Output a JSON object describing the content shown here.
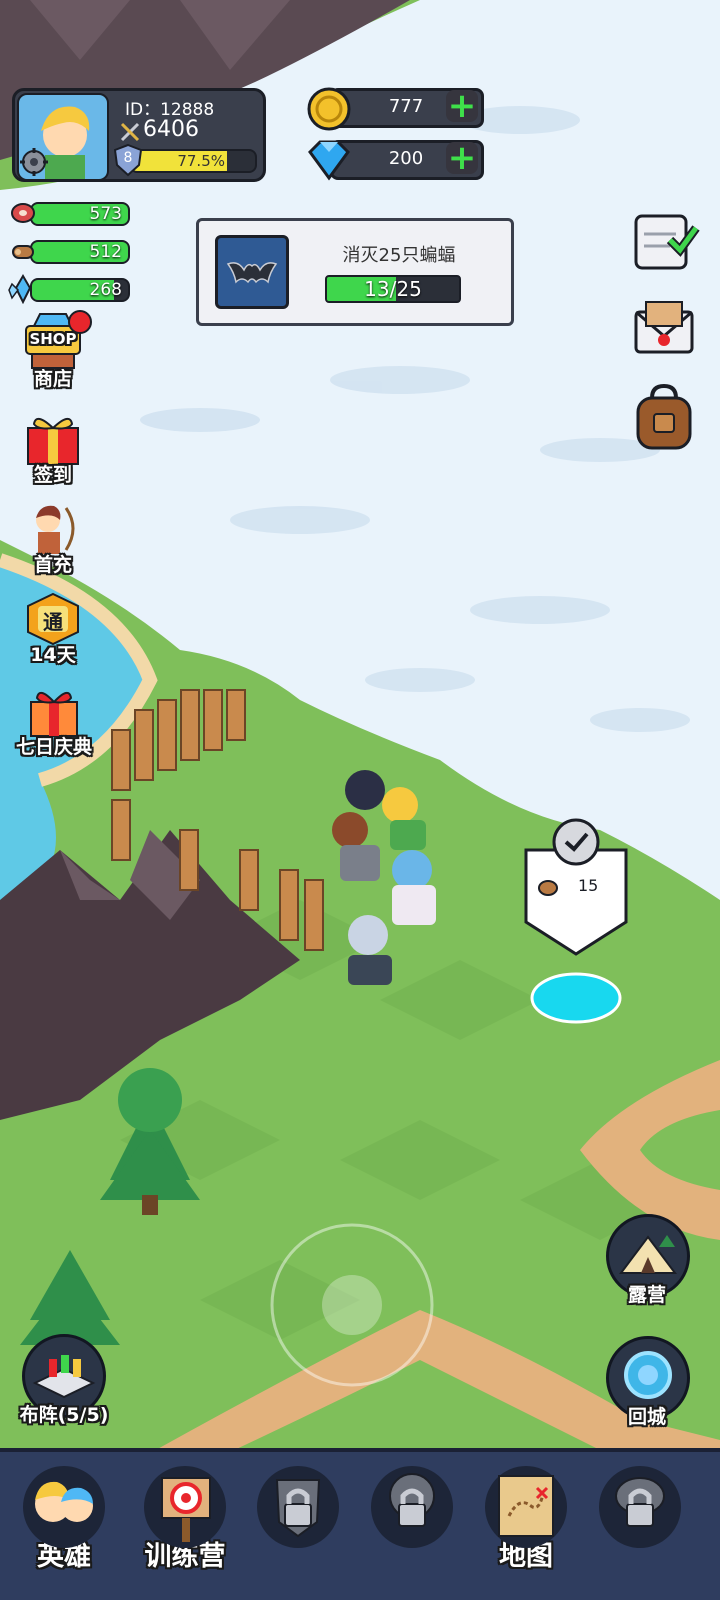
{
  "player": {
    "id_label": "ID：12888",
    "power": "6406",
    "level": "8",
    "exp_percent": "77.5%",
    "exp_fraction": 0.775
  },
  "currency": {
    "gold": "777",
    "gems": "200"
  },
  "resources": {
    "meat": "573",
    "wood": "512",
    "crystal": "268"
  },
  "quest": {
    "title": "消灭25只蝙蝠",
    "progress": "13/25",
    "fraction": 0.52
  },
  "left_menu": {
    "shop_badge": "SHOP",
    "shop": "商店",
    "checkin": "签到",
    "first_recharge": "首充",
    "pass_badge": "通",
    "pass_days": "14天",
    "seven_day": "七日庆典"
  },
  "map_marker": {
    "cost": "15"
  },
  "right_buttons": {
    "camp": "露营",
    "return_city": "回城",
    "formation": "布阵(5/5)"
  },
  "nav": {
    "heroes": "英雄",
    "training": "训练营",
    "map": "地图"
  },
  "colors": {
    "exp_bar": "#f1e23a",
    "resource_bar": "#3fd64c",
    "quest_bar": "#3fd64c",
    "grass": "#7fbf5a",
    "snow": "#e9f3fb"
  },
  "icons": [
    "settings-gear-icon",
    "sword-icon",
    "shield-level-icon",
    "gold-coin-icon",
    "gem-icon",
    "plus-icon",
    "meat-icon",
    "wood-icon",
    "crystal-icon",
    "bat-icon",
    "task-checklist-icon",
    "mail-icon",
    "backpack-icon",
    "lock-icon"
  ]
}
